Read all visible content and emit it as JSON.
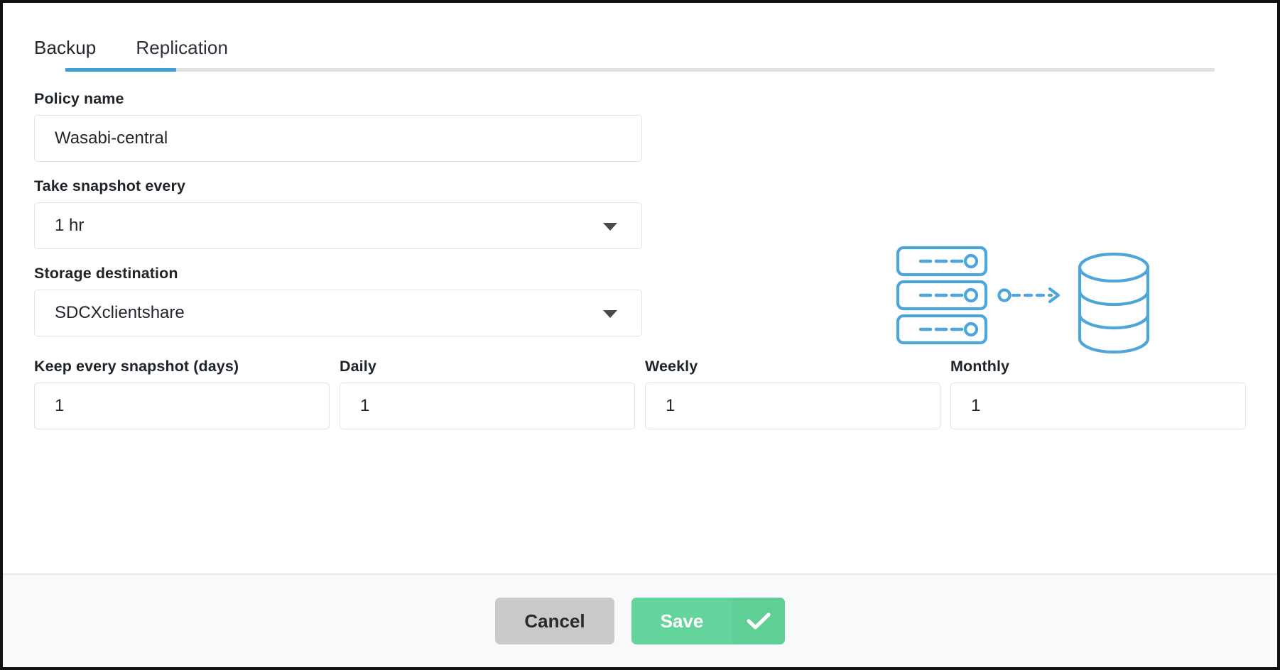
{
  "dialog": {
    "tabs": [
      {
        "label": "Backup",
        "active": true
      },
      {
        "label": "Replication",
        "active": false
      }
    ],
    "accent_color": "#3f9fd2",
    "fields": {
      "policy_name": {
        "label": "Policy name",
        "value": "Wasabi-central"
      },
      "snapshot_interval": {
        "label": "Take snapshot every",
        "value": "1 hr"
      },
      "storage_destination": {
        "label": "Storage destination",
        "value": "SDCXclientshare"
      }
    },
    "retention": [
      {
        "label": "Keep every snapshot (days)",
        "value": "1"
      },
      {
        "label": "Daily",
        "value": "1"
      },
      {
        "label": "Weekly",
        "value": "1"
      },
      {
        "label": "Monthly",
        "value": "1"
      }
    ],
    "illustration": {
      "name": "servers-to-database-backup-illustration",
      "color": "#4da6d9"
    },
    "footer": {
      "cancel_label": "Cancel",
      "save_label": "Save",
      "save_color": "#63d49b",
      "cancel_color": "#c9c9c9"
    }
  }
}
